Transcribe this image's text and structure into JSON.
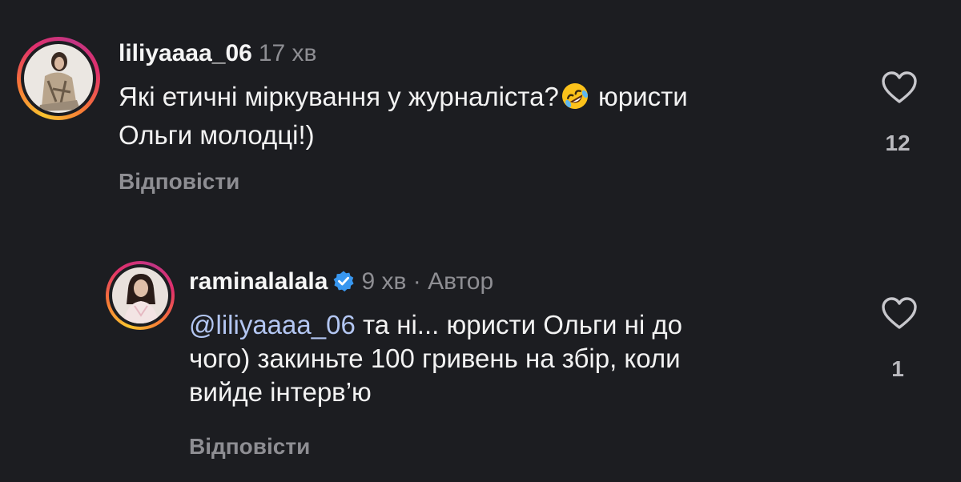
{
  "comments": [
    {
      "username": "liliyaaaa_06",
      "time": "17 хв",
      "text_line1_a": "Які етичні міркування у журналіста?",
      "emoji": "rolling-on-floor-laughing-emoji",
      "text_line1_b": " юристи",
      "text_line2": "Ольги молодці!)",
      "like_count": "12",
      "reply_label": "Відповісти"
    },
    {
      "username": "raminalalala",
      "verified": true,
      "time": "9 хв",
      "separator": "·",
      "author_label": "Автор",
      "mention": "@liliyaaaa_06",
      "text_line1": " та ні... юристи Ольги ні до",
      "text_line2": "чого) закиньте 100 гривень на збір, коли",
      "text_line3": "вийде інтерв’ю",
      "like_count": "1",
      "reply_label": "Відповісти"
    }
  ],
  "colors": {
    "background": "#1c1d21",
    "text": "#f2f2f2",
    "secondary": "#8e8e93",
    "mention": "#b3c6f2",
    "verified": "#3897f0"
  },
  "icons": [
    "heart-outline-icon",
    "verified-badge-icon"
  ]
}
